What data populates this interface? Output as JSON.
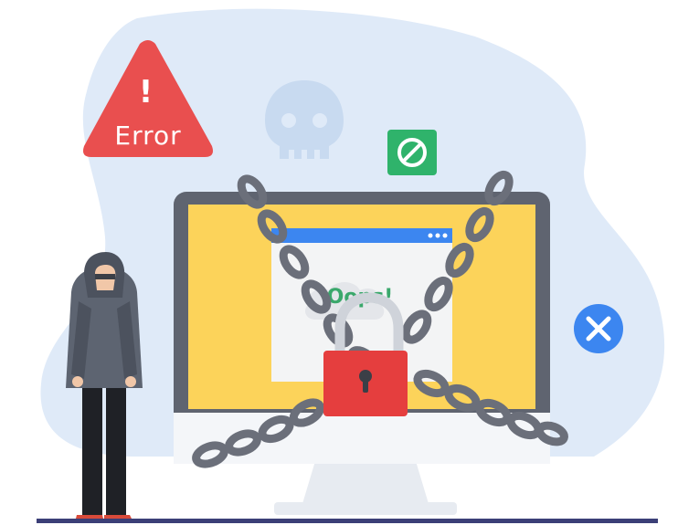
{
  "illustration": {
    "error_sign": {
      "label": "Error",
      "mark": "!"
    },
    "browser_message": "Oops!",
    "icons": [
      "warning-triangle-icon",
      "skull-icon",
      "blocked-icon",
      "close-circle-icon",
      "padlock-icon",
      "chain-icon"
    ]
  },
  "colors": {
    "blob": "#dfeaf8",
    "error_red": "#e94f4f",
    "blocked_green": "#2fb36b",
    "close_blue": "#3c86f0",
    "screen_yellow": "#fcd35a",
    "monitor_frame": "#5f6470",
    "lock_red": "#e53e3e",
    "chain": "#6b6f7a",
    "hoodie": "#5d6471",
    "oops_green": "#3aa86b"
  }
}
